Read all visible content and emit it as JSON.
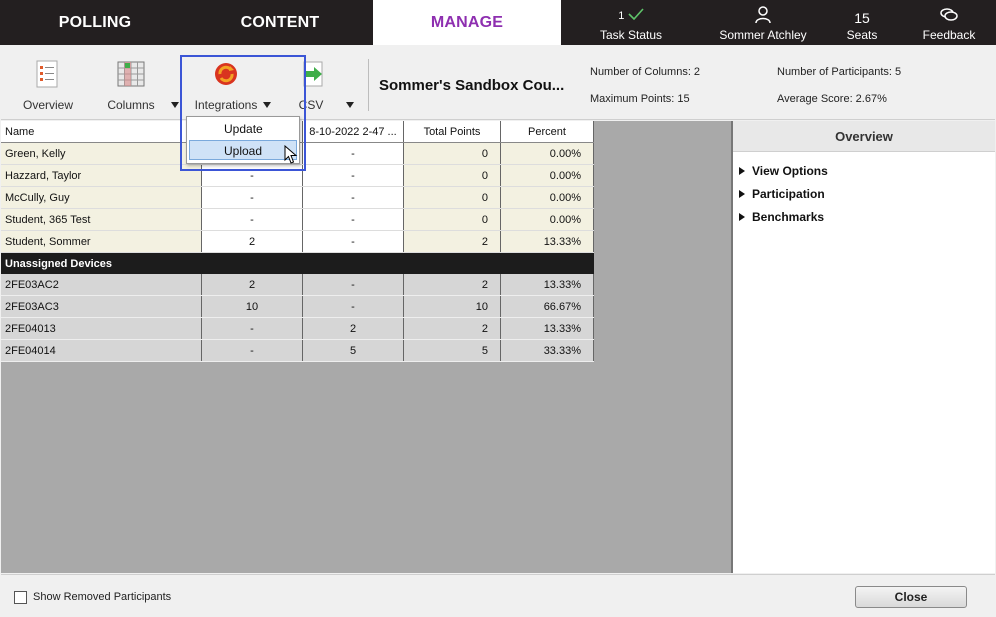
{
  "topbar": {
    "tabs": [
      {
        "label": "POLLING"
      },
      {
        "label": "CONTENT"
      },
      {
        "label": "MANAGE",
        "active": true
      }
    ],
    "task_status": {
      "count": "1",
      "label": "Task Status"
    },
    "user": {
      "label": "Sommer Atchley"
    },
    "seats": {
      "count": "15",
      "label": "Seats"
    },
    "feedback": {
      "label": "Feedback"
    }
  },
  "toolbar": {
    "overview_label": "Overview",
    "columns_label": "Columns",
    "integrations_label": "Integrations",
    "csv_label": "CSV",
    "course_title": "Sommer's Sandbox Cou...",
    "num_columns": "Number of Columns: 2",
    "max_points": "Maximum Points: 15",
    "num_participants": "Number of Participants: 5",
    "avg_score": "Average Score: 2.67%"
  },
  "integrations_menu": {
    "items": [
      {
        "label": "Update"
      },
      {
        "label": "Upload",
        "highlighted": true
      }
    ]
  },
  "table": {
    "headers": [
      "Name",
      "",
      "8-10-2022 2-47 ...",
      "Total Points",
      "Percent"
    ],
    "students": [
      {
        "name": "Green, Kelly",
        "c1": "",
        "c2": "-",
        "total": "0",
        "percent": "0.00%"
      },
      {
        "name": "Hazzard, Taylor",
        "c1": "-",
        "c2": "-",
        "total": "0",
        "percent": "0.00%"
      },
      {
        "name": "McCully, Guy",
        "c1": "-",
        "c2": "-",
        "total": "0",
        "percent": "0.00%"
      },
      {
        "name": "Student, 365 Test",
        "c1": "-",
        "c2": "-",
        "total": "0",
        "percent": "0.00%"
      },
      {
        "name": "Student, Sommer",
        "c1": "2",
        "c2": "-",
        "total": "2",
        "percent": "13.33%"
      }
    ],
    "section_label": "Unassigned Devices",
    "devices": [
      {
        "name": "2FE03AC2",
        "c1": "2",
        "c2": "-",
        "total": "2",
        "percent": "13.33%"
      },
      {
        "name": "2FE03AC3",
        "c1": "10",
        "c2": "-",
        "total": "10",
        "percent": "66.67%"
      },
      {
        "name": "2FE04013",
        "c1": "-",
        "c2": "2",
        "total": "2",
        "percent": "13.33%"
      },
      {
        "name": "2FE04014",
        "c1": "-",
        "c2": "5",
        "total": "5",
        "percent": "33.33%"
      }
    ]
  },
  "overview": {
    "title": "Overview",
    "items": [
      {
        "label": "View Options"
      },
      {
        "label": "Participation"
      },
      {
        "label": "Benchmarks"
      }
    ]
  },
  "footer": {
    "show_removed_label": "Show Removed Participants",
    "close_label": "Close"
  },
  "colors": {
    "accent_purple": "#8e2fb0",
    "topbar_bg": "#231f20",
    "highlight_border": "#3b55d6",
    "student_row_bg": "#f3f1e1"
  }
}
